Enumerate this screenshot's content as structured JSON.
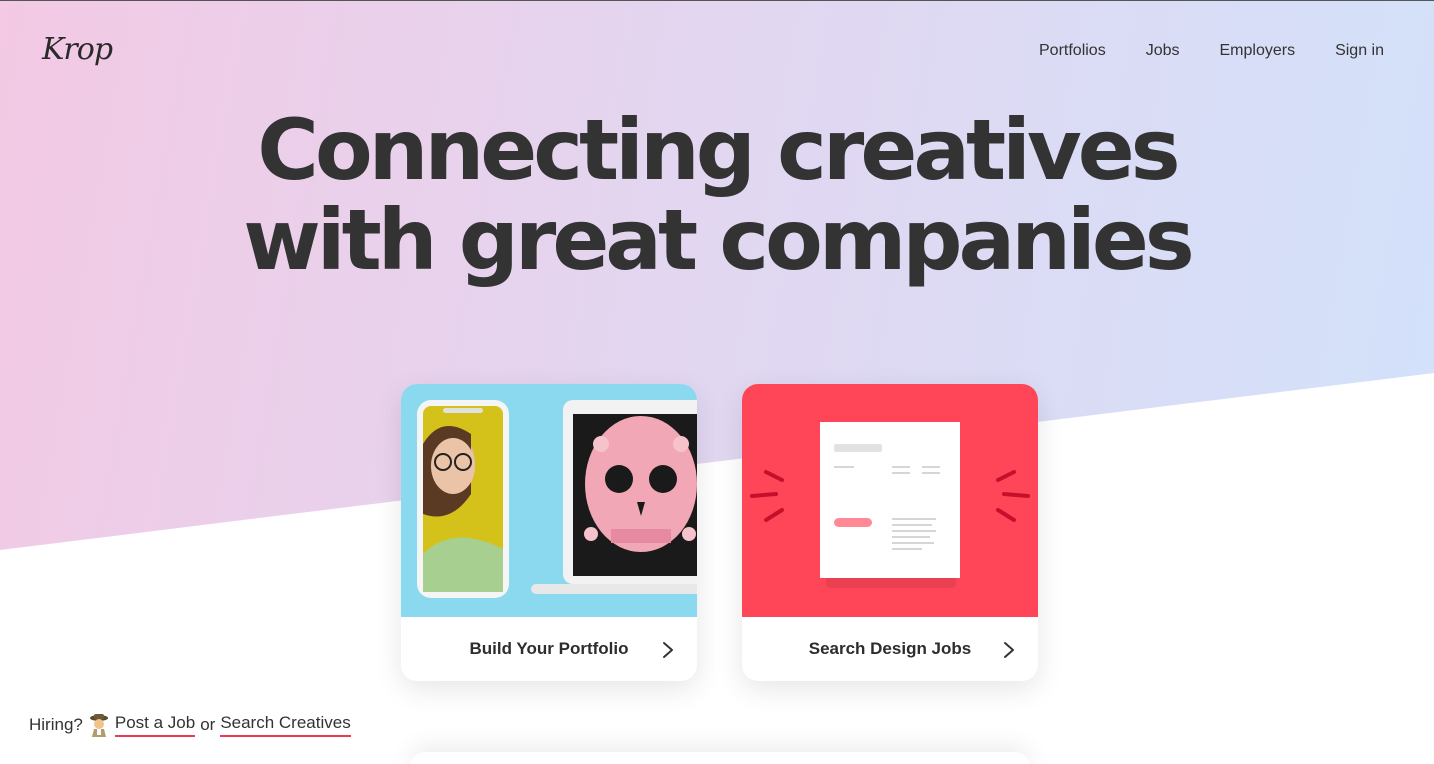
{
  "brand": {
    "logo_text": "Krop"
  },
  "nav": {
    "items": [
      {
        "label": "Portfolios"
      },
      {
        "label": "Jobs"
      },
      {
        "label": "Employers"
      },
      {
        "label": "Sign in"
      }
    ]
  },
  "hero": {
    "headline_line1": "Connecting creatives",
    "headline_line2": "with great companies"
  },
  "cards": [
    {
      "label": "Build Your Portfolio",
      "icon": "chevron-right-icon"
    },
    {
      "label": "Search Design Jobs",
      "icon": "chevron-right-icon"
    }
  ],
  "hiring": {
    "prefix": "Hiring?",
    "emoji": "detective-emoji",
    "post_job": "Post a Job",
    "or": "or",
    "search_creatives": "Search Creatives"
  },
  "colors": {
    "accent": "#ee3a4e",
    "jobs_card_bg": "#ff4658",
    "portfolio_card_bg": "#8ad9ee"
  }
}
